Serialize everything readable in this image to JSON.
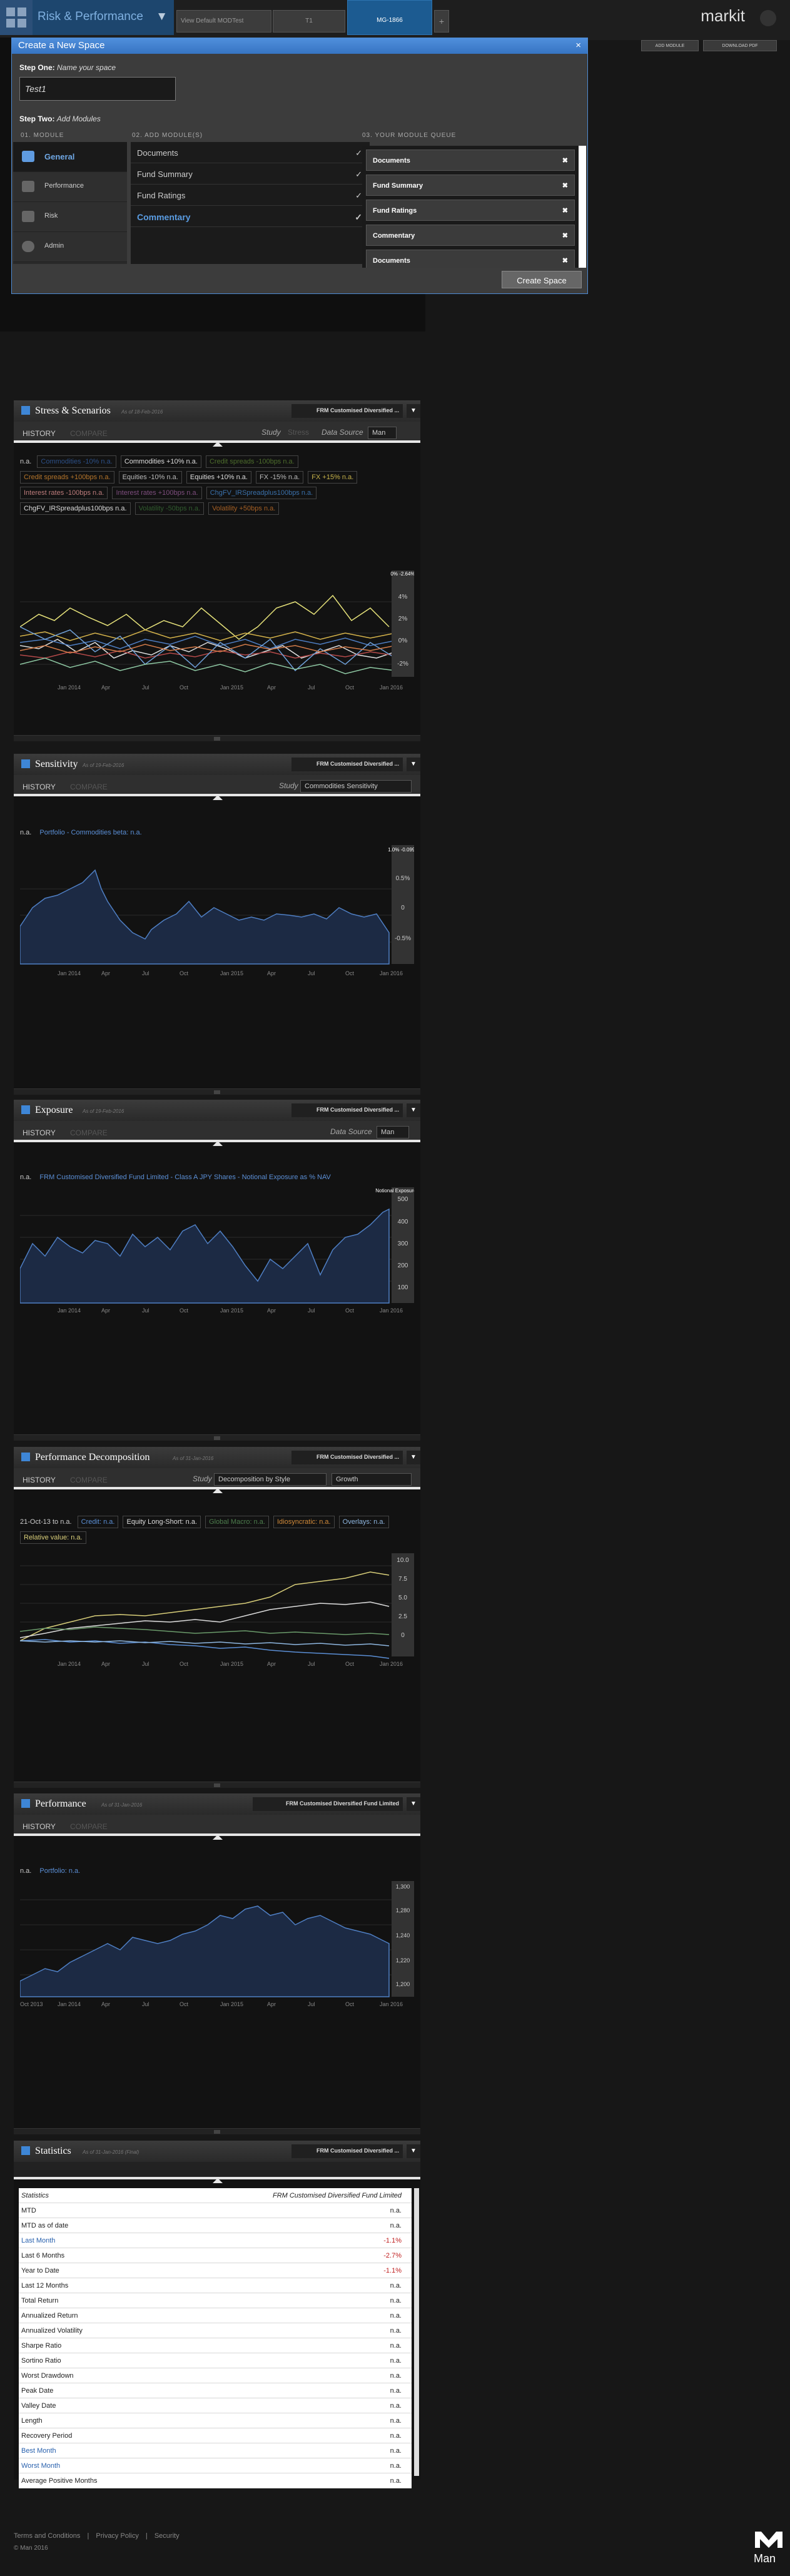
{
  "header": {
    "app_title": "Risk & Performance",
    "tabs": [
      {
        "label": "View Default MODTest"
      },
      {
        "label": "T1"
      },
      {
        "label": "MG-1866"
      }
    ],
    "add_tab": "+",
    "brand": "markit",
    "buttons": {
      "add_module": "ADD MODULE",
      "download_pdf": "DOWNLOAD PDF"
    }
  },
  "modal": {
    "title": "Create a New Space",
    "close": "×",
    "step_one": "Step One:",
    "step_one_text": "Name your space",
    "name_value": "Test1",
    "step_two": "Step Two:",
    "step_two_text": "Add Modules",
    "col1": "01. MODULE",
    "col2": "02. ADD MODULE(S)",
    "col3": "03. YOUR MODULE QUEUE",
    "modules": [
      {
        "label": "General",
        "icon": "share-icon"
      },
      {
        "label": "Performance",
        "icon": "line-chart-icon"
      },
      {
        "label": "Risk",
        "icon": "bar-chart-icon"
      },
      {
        "label": "Admin",
        "icon": "gear-icon"
      }
    ],
    "add_items": [
      {
        "label": "Documents"
      },
      {
        "label": "Fund Summary"
      },
      {
        "label": "Fund Ratings"
      },
      {
        "label": "Commentary"
      }
    ],
    "queue": [
      {
        "label": "Documents"
      },
      {
        "label": "Fund Summary"
      },
      {
        "label": "Fund Ratings"
      },
      {
        "label": "Commentary"
      },
      {
        "label": "Documents"
      }
    ],
    "create_button": "Create Space"
  },
  "stress": {
    "title": "Stress & Scenarios",
    "asof": "As of 18-Feb-2016",
    "selector": "FRM Customised Diversified ...",
    "tab_history": "HISTORY",
    "tab_compare": "COMPARE",
    "study_label": "Study",
    "study_value": "Stress",
    "source_label": "Data Source",
    "source_value": "Man",
    "legend_na": "n.a.",
    "tags": [
      "Commodities -10% n.a.",
      "Commodities +10% n.a.",
      "Credit spreads -100bps n.a.",
      "Credit spreads +100bps n.a.",
      "Equities -10% n.a.",
      "Equities +10% n.a.",
      "FX -15% n.a.",
      "FX +15% n.a.",
      "Interest rates -100bps n.a.",
      "Interest rates +100bps n.a.",
      "ChgFV_IRSpreadplus100bps n.a.",
      "ChgFV_IRSpreadplus100bps n.a.",
      "Volatility -50bps n.a.",
      "Volatility +50bps n.a."
    ],
    "y_ticks": [
      "4%",
      "2%",
      "0%",
      "-2%"
    ],
    "cursor": "0% -2.64%",
    "x_ticks": [
      "Jan 2014",
      "Apr",
      "Jul",
      "Oct",
      "Jan 2015",
      "Apr",
      "Jul",
      "Oct",
      "Jan 2016"
    ]
  },
  "sensitivity": {
    "title": "Sensitivity",
    "asof": "As of 19-Feb-2016",
    "selector": "FRM Customised Diversified ...",
    "tab_history": "HISTORY",
    "tab_compare": "COMPARE",
    "study_label": "Study",
    "study_value": "Commodities Sensitivity",
    "legend_na": "n.a.",
    "legend_series": "Portfolio - Commodities beta: n.a.",
    "y_ticks": [
      "0.5%",
      "0",
      "-0.5%"
    ],
    "cursor": "1.0% -0.0998",
    "x_ticks": [
      "Jan 2014",
      "Apr",
      "Jul",
      "Oct",
      "Jan 2015",
      "Apr",
      "Jul",
      "Oct",
      "Jan 2016"
    ]
  },
  "exposure": {
    "title": "Exposure",
    "asof": "As of 19-Feb-2016",
    "selector": "FRM Customised Diversified ...",
    "tab_history": "HISTORY",
    "tab_compare": "COMPARE",
    "source_label": "Data Source",
    "source_value": "Man",
    "legend_na": "n.a.",
    "legend_series": "FRM Customised Diversified Fund Limited - Class A JPY Shares - Notional Exposure as % NAV",
    "y_ticks": [
      "500",
      "400",
      "300",
      "200",
      "100"
    ],
    "cursor": "Notional Exposure 450.9",
    "x_ticks": [
      "Jan 2014",
      "Apr",
      "Jul",
      "Oct",
      "Jan 2015",
      "Apr",
      "Jul",
      "Oct",
      "Jan 2016"
    ]
  },
  "decomp": {
    "title": "Performance Decomposition",
    "asof": "As of 31-Jan-2016",
    "selector": "FRM Customised Diversified ...",
    "tab_history": "HISTORY",
    "tab_compare": "COMPARE",
    "study_label": "Study",
    "study_value": "Decomposition by Style",
    "growth_value": "Growth",
    "date_label": "21-Oct-13 to n.a.",
    "tags": [
      "Credit: n.a.",
      "Equity Long-Short: n.a.",
      "Global Macro: n.a.",
      "Idiosyncratic: n.a.",
      "Overlays: n.a.",
      "Relative value: n.a."
    ],
    "y_ticks": [
      "10.0",
      "7.5",
      "5.0",
      "2.5",
      "0"
    ],
    "x_ticks": [
      "Jan 2014",
      "Apr",
      "Jul",
      "Oct",
      "Jan 2015",
      "Apr",
      "Jul",
      "Oct",
      "Jan 2016"
    ]
  },
  "performance": {
    "title": "Performance",
    "asof": "As of 31-Jan-2016",
    "selector": "FRM Customised Diversified Fund Limited",
    "tab_history": "HISTORY",
    "tab_compare": "COMPARE",
    "legend_na": "n.a.",
    "legend_series": "Portfolio: n.a.",
    "y_ticks": [
      "1,300",
      "1,280",
      "1,240",
      "1,220",
      "1,200"
    ],
    "x_ticks": [
      "Oct 2013",
      "Jan 2014",
      "Apr",
      "Jul",
      "Oct",
      "Jan 2015",
      "Apr",
      "Jul",
      "Oct",
      "Jan 2016"
    ]
  },
  "statistics": {
    "title": "Statistics",
    "asof": "As of 31-Jan-2016 (Final)",
    "selector": "FRM Customised Diversified ...",
    "header_label": "Statistics",
    "header_value": "FRM Customised Diversified Fund Limited",
    "rows": [
      [
        "MTD",
        "n.a."
      ],
      [
        "MTD as of date",
        "n.a."
      ],
      [
        "Last Month",
        "-1.1%"
      ],
      [
        "Last 6 Months",
        "-2.7%"
      ],
      [
        "Year to Date",
        "-1.1%"
      ],
      [
        "Last 12 Months",
        "n.a."
      ],
      [
        "Total Return",
        "n.a."
      ],
      [
        "Annualized Return",
        "n.a."
      ],
      [
        "Annualized Volatility",
        "n.a."
      ],
      [
        "Sharpe Ratio",
        "n.a."
      ],
      [
        "Sortino Ratio",
        "n.a."
      ],
      [
        "Worst Drawdown",
        "n.a."
      ],
      [
        "Peak Date",
        "n.a."
      ],
      [
        "Valley Date",
        "n.a."
      ],
      [
        "Length",
        "n.a."
      ],
      [
        "Recovery Period",
        "n.a."
      ],
      [
        "Best Month",
        "n.a."
      ],
      [
        "Worst Month",
        "n.a."
      ],
      [
        "Average Positive Months",
        "n.a."
      ]
    ]
  },
  "footer": {
    "terms": "Terms and Conditions",
    "privacy": "Privacy Policy",
    "security": "Security",
    "copyright": "© Man 2016",
    "logo": "Man"
  }
}
